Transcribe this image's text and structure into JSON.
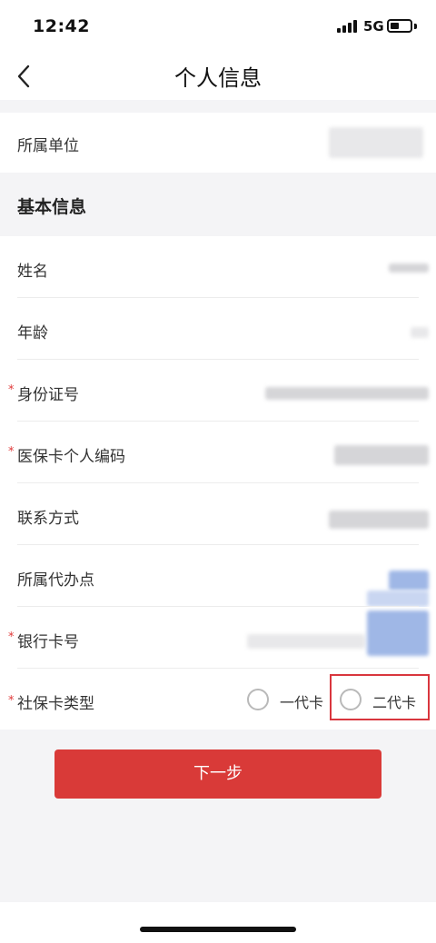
{
  "status_bar": {
    "time": "12:42",
    "network": "5G"
  },
  "nav": {
    "title": "个人信息",
    "back_icon": "chevron-left-icon"
  },
  "org_row": {
    "label": "所属单位"
  },
  "section": {
    "title": "基本信息"
  },
  "fields": [
    {
      "label": "姓名",
      "required": false
    },
    {
      "label": "年龄",
      "required": false
    },
    {
      "label": "身份证号",
      "required": true
    },
    {
      "label": "医保卡个人编码",
      "required": true
    },
    {
      "label": "联系方式",
      "required": false
    },
    {
      "label": "所属代办点",
      "required": false
    },
    {
      "label": "银行卡号",
      "required": true
    }
  ],
  "card_type": {
    "label": "社保卡类型",
    "required": true,
    "options": [
      "一代卡",
      "二代卡"
    ]
  },
  "required_marker": "*",
  "next_button": "下一步",
  "colors": {
    "accent": "#d93a38",
    "required": "#e03a3a",
    "highlight": "#d9363e",
    "background_gray": "#f4f4f6"
  }
}
